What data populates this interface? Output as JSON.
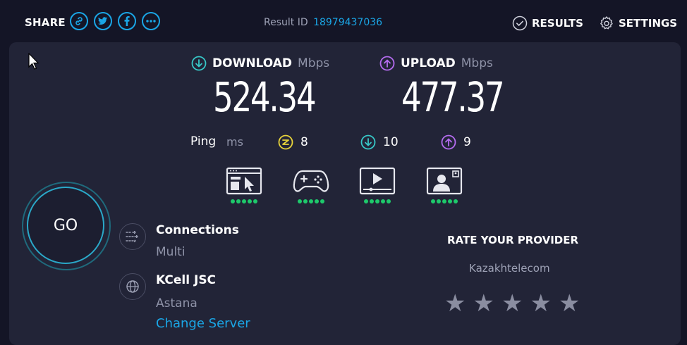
{
  "header": {
    "share_label": "SHARE",
    "share_icons": [
      "link-icon",
      "twitter-icon",
      "facebook-icon",
      "more-icon"
    ],
    "result_id_label": "Result ID",
    "result_id_value": "18979437036",
    "results_label": "RESULTS",
    "settings_label": "SETTINGS"
  },
  "metrics": {
    "download": {
      "label": "DOWNLOAD",
      "unit": "Mbps",
      "value": "524.34"
    },
    "upload": {
      "label": "UPLOAD",
      "unit": "Mbps",
      "value": "477.37"
    }
  },
  "ping": {
    "label": "Ping",
    "unit": "ms",
    "jitter": "8",
    "download": "10",
    "upload": "9"
  },
  "apps": [
    {
      "icon": "web-browsing-icon",
      "rating": 5
    },
    {
      "icon": "gaming-icon",
      "rating": 5
    },
    {
      "icon": "video-streaming-icon",
      "rating": 5
    },
    {
      "icon": "video-chat-icon",
      "rating": 5
    }
  ],
  "go_label": "GO",
  "connections": {
    "title": "Connections",
    "value": "Multi"
  },
  "server": {
    "name": "KCell JSC",
    "city": "Astana",
    "change_label": "Change Server"
  },
  "rating": {
    "title": "RATE YOUR PROVIDER",
    "isp": "Kazakhtelecom",
    "stars": 5
  },
  "colors": {
    "accent_blue": "#1aa6e6",
    "download_teal": "#37c8c8",
    "upload_purple": "#b56cf0",
    "jitter_yellow": "#e8d43a",
    "good_green": "#1ec96b",
    "panel_bg": "#222437",
    "page_bg": "#141526"
  }
}
